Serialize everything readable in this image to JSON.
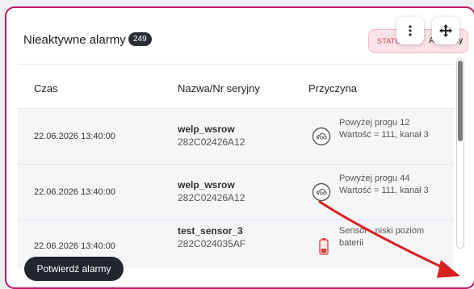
{
  "card": {
    "title": "Nieaktywne alarmy",
    "count": "249",
    "status_label": "STATUS",
    "status_value": "Aktywny"
  },
  "table": {
    "headers": [
      "Czas",
      "Nazwa/Nr seryjny",
      "Przyczyna"
    ],
    "rows": [
      {
        "time": "22.06.2026 13:40:00",
        "name": "welp_wsrow",
        "serial": "282C02426A12",
        "reason": "Powyżej progu 12 Wartość = 111, kanał 3",
        "icon": "voc-icon"
      },
      {
        "time": "22.06.2026 13:40:00",
        "name": "welp_wsrow",
        "serial": "282C02426A12",
        "reason": "Powyżej progu 44 Wartość = 111, kanał 3",
        "icon": "voc-icon"
      },
      {
        "time": "22.06.2026 13:40:00",
        "name": "test_sensor_3",
        "serial": "282C024035AF",
        "reason": "Sensor - niski poziom baterii",
        "icon": "battery-low-icon"
      }
    ]
  },
  "icons": {
    "more": "more-vertical-icon",
    "move": "move-icon",
    "resize": "resize-arrow-icon"
  },
  "colors": {
    "border": "#c2186b",
    "status_bg": "#fbe3e7",
    "button_bg": "#23262f",
    "arrow": "#d92020"
  },
  "actions": {
    "confirm_label": "Potwierdź alarmy"
  }
}
